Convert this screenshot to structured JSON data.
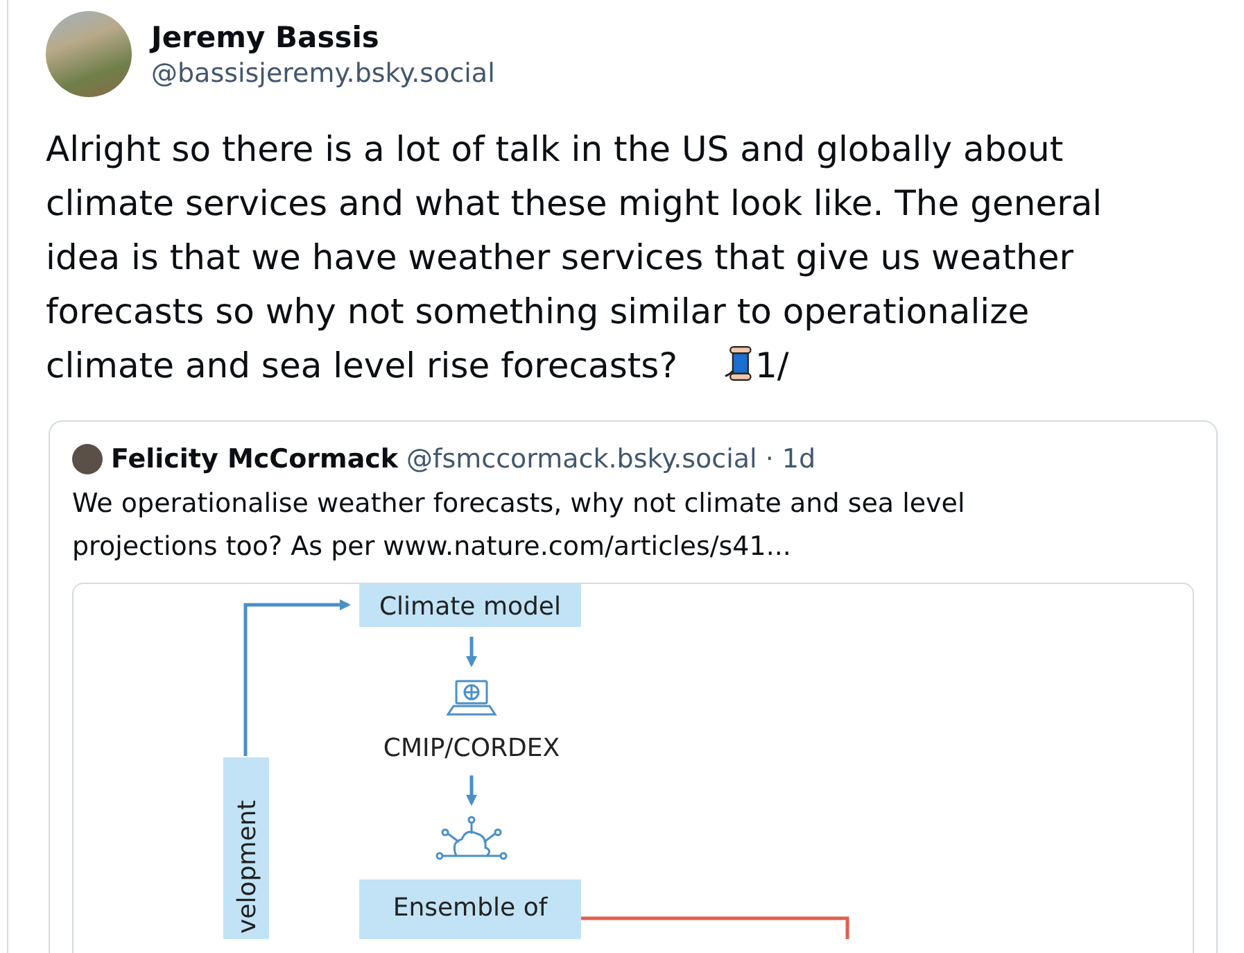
{
  "author": {
    "name": "Jeremy Bassis",
    "handle": "@bassisjeremy.bsky.social"
  },
  "post": {
    "text": "Alright so there is a lot of talk in the US and globally about climate services and what these might look like.  The general idea is that we have weather services that give us weather forecasts so why not something similar to operationalize climate and sea level rise forecasts?",
    "thread_marker": "1/"
  },
  "quote": {
    "author": {
      "name": "Felicity McCormack",
      "handle": "@fsmccormack.bsky.social",
      "separator": "·",
      "time": "1d"
    },
    "text": "We operationalise weather forecasts, why not climate and sea level projections too? As per www.nature.com/articles/s41...",
    "figure": {
      "climate_model_label": "Climate model",
      "database_label": "CMIP/CORDEX",
      "ensemble_label": "Ensemble of",
      "side_label": "velopment"
    }
  }
}
